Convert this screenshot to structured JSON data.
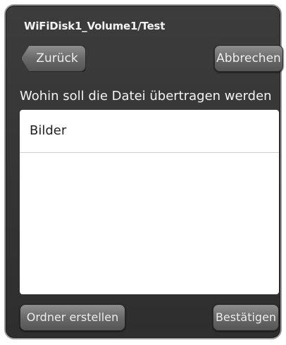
{
  "dialog": {
    "title": "WiFiDisk1_Volume1/Test",
    "back_label": "Zurück",
    "cancel_label": "Abbrechen",
    "prompt": "Wohin soll die Datei übertragen werden",
    "folders": [
      {
        "label": "Bilder"
      }
    ],
    "create_folder_label": "Ordner erstellen",
    "confirm_label": "Bestätigen"
  }
}
